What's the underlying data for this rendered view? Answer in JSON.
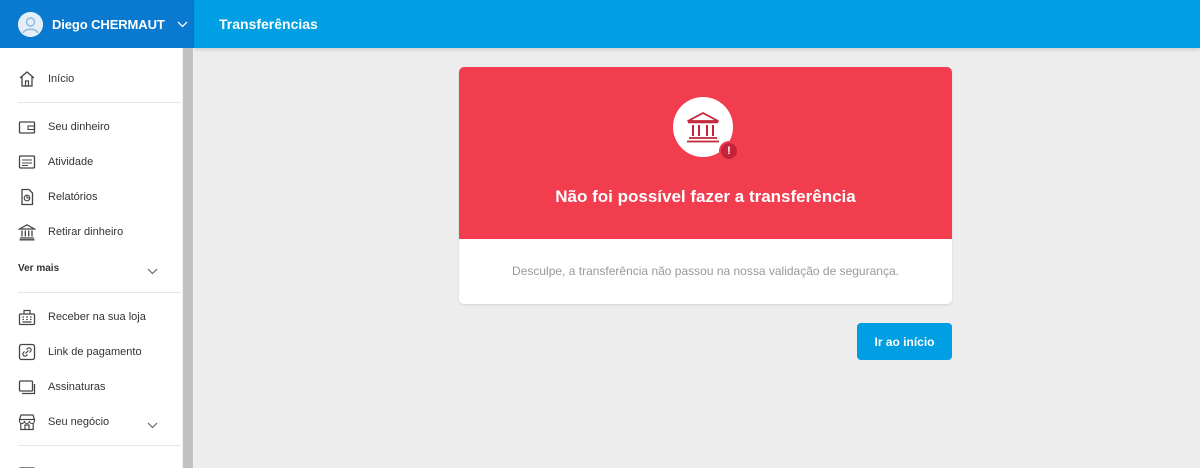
{
  "user": {
    "name": "Diego CHERMAUT"
  },
  "header": {
    "title": "Transferências"
  },
  "sidebar": {
    "items": [
      {
        "label": "Início",
        "icon": "home-icon"
      },
      {
        "label": "Seu dinheiro",
        "icon": "wallet-icon"
      },
      {
        "label": "Atividade",
        "icon": "activity-list-icon"
      },
      {
        "label": "Relatórios",
        "icon": "report-document-icon"
      },
      {
        "label": "Retirar dinheiro",
        "icon": "bank-icon"
      },
      {
        "label": "Receber na sua loja",
        "icon": "cash-register-icon"
      },
      {
        "label": "Link de pagamento",
        "icon": "link-icon"
      },
      {
        "label": "Assinaturas",
        "icon": "subscriptions-icon"
      },
      {
        "label": "Seu negócio",
        "icon": "store-icon"
      }
    ],
    "see_more": "Ver mais"
  },
  "error_card": {
    "title": "Não foi possível fazer a transferência",
    "message": "Desculpe, a transferência não passou na nossa validação de segurança.",
    "icon": "bank-icon",
    "badge": "!"
  },
  "actions": {
    "home_button": "Ir ao início"
  },
  "colors": {
    "primary": "#009ee3",
    "user_block": "#0a7ad0",
    "error": "#f23d4f",
    "badge": "#c4233a"
  }
}
